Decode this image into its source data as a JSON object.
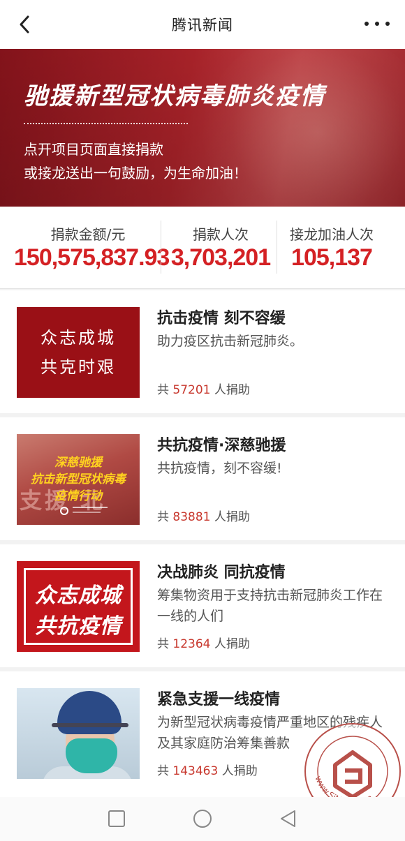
{
  "header": {
    "title": "腾讯新闻",
    "back_icon": "chevron-left-icon",
    "more_icon": "more-dots-icon"
  },
  "banner": {
    "title": "驰援新型冠状病毒肺炎疫情",
    "line1": "点开项目页面直接捐款",
    "line2": "或接龙送出一句鼓励，为生命加油！"
  },
  "stats": [
    {
      "label": "捐款金额/元",
      "value": "150,575,837.93"
    },
    {
      "label": "捐款人次",
      "value": "3,703,201"
    },
    {
      "label": "接龙加油人次",
      "value": "105,137"
    }
  ],
  "projects": [
    {
      "title": "抗击疫情 刻不容缓",
      "desc": "助力疫区抗击新冠肺炎。",
      "count_prefix": "共",
      "count": "57201",
      "count_suffix": "人捐助",
      "thumb_lines": [
        "众志成城",
        "共克时艰"
      ]
    },
    {
      "title": "共抗疫情·深慈驰援",
      "desc": "共抗疫情，刻不容缓!",
      "count_prefix": "共",
      "count": "83881",
      "count_suffix": "人捐助",
      "thumb_lines": [
        "深慈驰援",
        "抗击新型冠状病毒",
        "疫情行动"
      ]
    },
    {
      "title": "决战肺炎 同抗疫情",
      "desc": "筹集物资用于支持抗击新冠肺炎工作在一线的人们",
      "count_prefix": "共",
      "count": "12364",
      "count_suffix": "人捐助",
      "thumb_lines": [
        "众志成城",
        "共抗疫情"
      ]
    },
    {
      "title": "紧急支援一线疫情",
      "desc": "为新型冠状病毒疫情严重地区的残疾人及其家庭防治筹集善款",
      "count_prefix": "共",
      "count": "143463",
      "count_suffix": "人捐助"
    }
  ],
  "watermark": {
    "text": "www.SiMu001.cn"
  },
  "navbar": {
    "icons": [
      "recent-apps-icon",
      "home-icon",
      "back-triangle-icon"
    ]
  },
  "colors": {
    "accent_red": "#d42124",
    "count_red": "#c8392f",
    "banner_red": "#b0242b"
  }
}
